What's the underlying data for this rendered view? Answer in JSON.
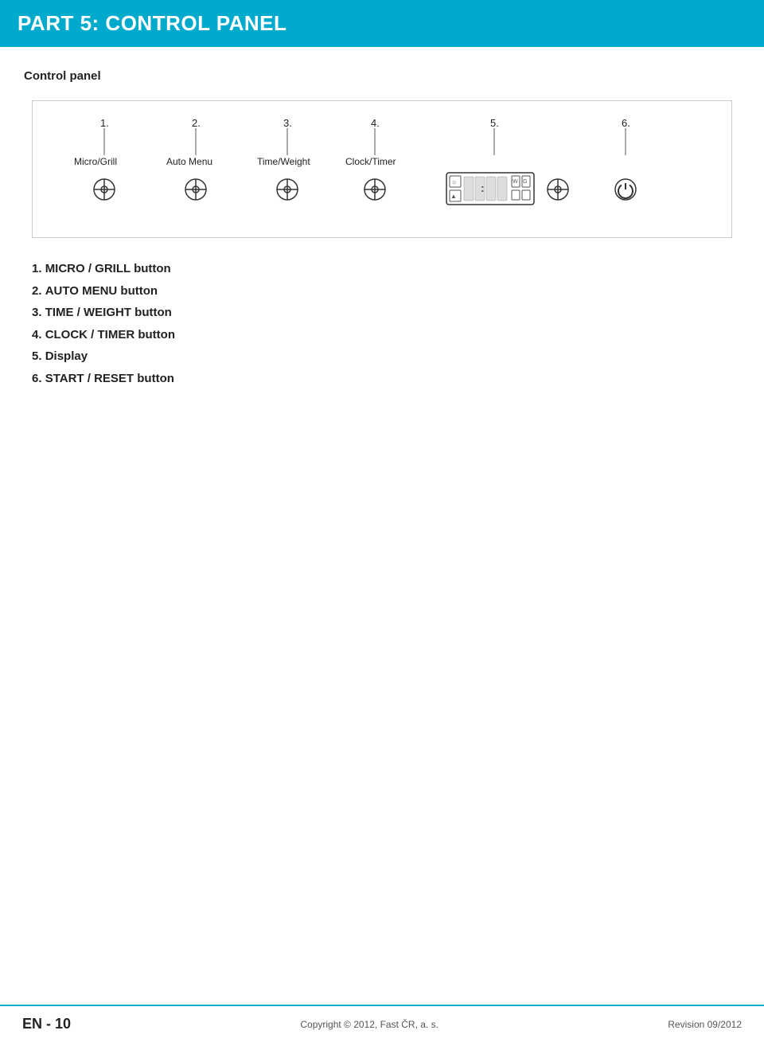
{
  "header": {
    "title": "PART 5: CONTROL PANEL"
  },
  "section": {
    "title": "Control panel"
  },
  "diagram": {
    "numbers": [
      "1.",
      "2.",
      "3.",
      "4.",
      "5.",
      "6."
    ],
    "labels": [
      "Micro/Grill",
      "Auto Menu",
      "Time/Weight",
      "Clock/Timer"
    ]
  },
  "items": [
    {
      "num": "1.",
      "label": "MICRO / GRILL button"
    },
    {
      "num": "2.",
      "label": "AUTO MENU button"
    },
    {
      "num": "3.",
      "label": "TIME / WEIGHT button"
    },
    {
      "num": "4.",
      "label": "CLOCK / TIMER button"
    },
    {
      "num": "5.",
      "label": "Display"
    },
    {
      "num": "6.",
      "label": "START / RESET button"
    }
  ],
  "footer": {
    "page": "EN - 10",
    "copyright": "Copyright © 2012, Fast ČR, a. s.",
    "revision": "Revision 09/2012"
  }
}
